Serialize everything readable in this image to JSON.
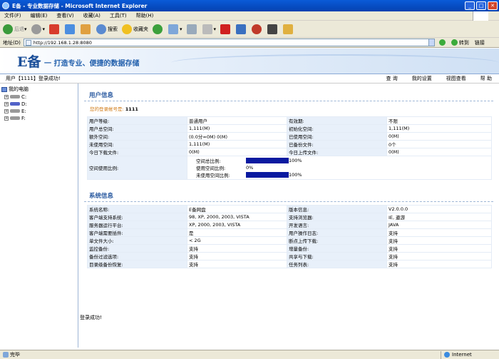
{
  "window": {
    "title": "E备 - 专业数据存储 - Microsoft Internet Explorer"
  },
  "menu": [
    "文件(F)",
    "编辑(E)",
    "查看(V)",
    "收藏(A)",
    "工具(T)",
    "帮助(H)"
  ],
  "toolbar": {
    "back": "后退",
    "search": "搜索",
    "favorites": "收藏夹"
  },
  "address": {
    "label": "地址(D)",
    "url": "http://192.168.1.28:8080",
    "go": "转到",
    "links": "链接"
  },
  "banner": {
    "logo": "E备",
    "slogan": "一 打造专业、便捷的数据存储"
  },
  "nav": {
    "login_msg": "用户【1111】登录成功!",
    "items": [
      "查 询",
      "我的设置",
      "视图查看",
      "帮 助"
    ]
  },
  "tree": {
    "root": "我的电脑",
    "drives": [
      "C:",
      "D:",
      "E:",
      "F:"
    ]
  },
  "user_info": {
    "title": "用户信息",
    "account_label": "您的登录帐号是:",
    "account": "1111",
    "rows": [
      {
        "k1": "用户等级:",
        "v1": "普通用户",
        "k2": "有效期:",
        "v2": "不限"
      },
      {
        "k1": "用户总空间:",
        "v1": "1,111(M)",
        "k2": "初始化空间:",
        "v2": "1,111(M)"
      },
      {
        "k1": "额外空间:",
        "v1": "(0.0分=0M) 0(M)",
        "k2": "已使用空间:",
        "v2": "0(M)"
      },
      {
        "k1": "未使用空间:",
        "v1": "1,111(M)",
        "k2": "已备份文件:",
        "v2": "0个"
      },
      {
        "k1": "今日下载文件:",
        "v1": "0(M)",
        "k2": "今日上传文件:",
        "v2": "0(M)"
      }
    ],
    "usage": {
      "label": "空间使用比例:",
      "bars": [
        {
          "name": "空间总比例:",
          "percent": 100,
          "text": "100%"
        },
        {
          "name": "使用空间比例:",
          "percent": 0,
          "text": "0%"
        },
        {
          "name": "未使用空间比例:",
          "percent": 100,
          "text": "100%"
        }
      ]
    }
  },
  "system_info": {
    "title": "系统信息",
    "rows": [
      {
        "k1": "系统名称:",
        "v1": "E备网盘",
        "k2": "版本信息:",
        "v2": "V2.0.0.0"
      },
      {
        "k1": "客户端支持系统:",
        "v1": "98, XP, 2000, 2003, VISTA",
        "k2": "支持浏览器:",
        "v2": "IE, 遨游"
      },
      {
        "k1": "服务器运行平台:",
        "v1": "XP, 2000, 2003, VISTA",
        "k2": "开发语言:",
        "v2": "JAVA"
      },
      {
        "k1": "客户端需要插件:",
        "v1": "是",
        "k2": "用户操作日志:",
        "v2": "支持"
      },
      {
        "k1": "单文件大小:",
        "v1": "< 2G",
        "k2": "断点上传下载:",
        "v2": "支持"
      },
      {
        "k1": "监控备份:",
        "v1": "支持",
        "k2": "增量备份:",
        "v2": "支持"
      },
      {
        "k1": "备份过滤选项:",
        "v1": "支持",
        "k2": "共享与下载:",
        "v2": "支持"
      },
      {
        "k1": "目录级备份恢复:",
        "v1": "支持",
        "k2": "任务列表:",
        "v2": "支持"
      }
    ]
  },
  "bottom_msg": "登录成功!",
  "status": {
    "left": "完毕",
    "zone": "Internet"
  }
}
